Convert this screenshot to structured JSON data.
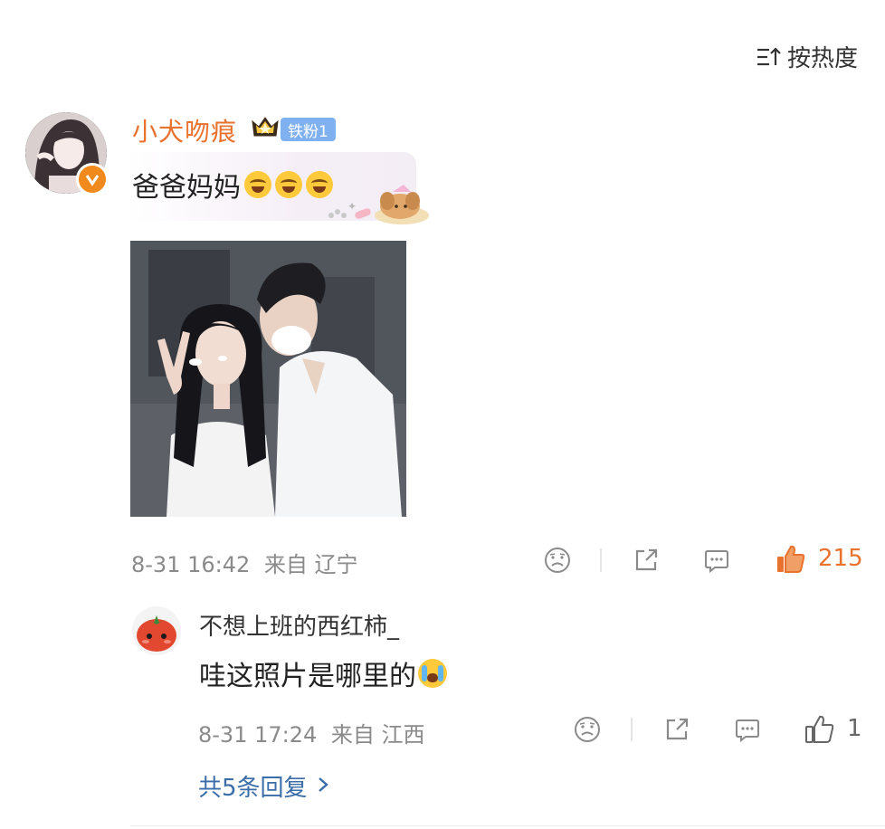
{
  "sort": {
    "label": "按热度",
    "icon": "sort-icon"
  },
  "comment": {
    "username": "小犬吻痕",
    "fan_badge": "铁粉1",
    "text": "爸爸妈妈",
    "emojis": [
      "laugh-emoji",
      "laugh-emoji",
      "laugh-emoji"
    ],
    "sticker": "dog-bubble-sticker",
    "meta": {
      "date": "8-31 16:42",
      "from": "来自 辽宁"
    },
    "actions": {
      "dislike_icon": "dislike-icon",
      "share_icon": "share-icon",
      "comment_icon": "comment-icon",
      "like_icon": "thumbs-up-icon",
      "like_count": "215"
    },
    "colors": {
      "username": "#e8722e",
      "badge": "#7fb1f0",
      "liked": "#e8722e"
    }
  },
  "reply": {
    "username": "不想上班的西红柿_",
    "text": "哇这照片是哪里的",
    "emoji": "crying-emoji",
    "meta": {
      "date": "8-31 17:24",
      "from": "来自 江西"
    },
    "actions": {
      "like_count": "1"
    }
  },
  "more_replies": {
    "label": "共5条回复",
    "icon": "chevron-right-icon",
    "color": "#3b6ea8"
  }
}
